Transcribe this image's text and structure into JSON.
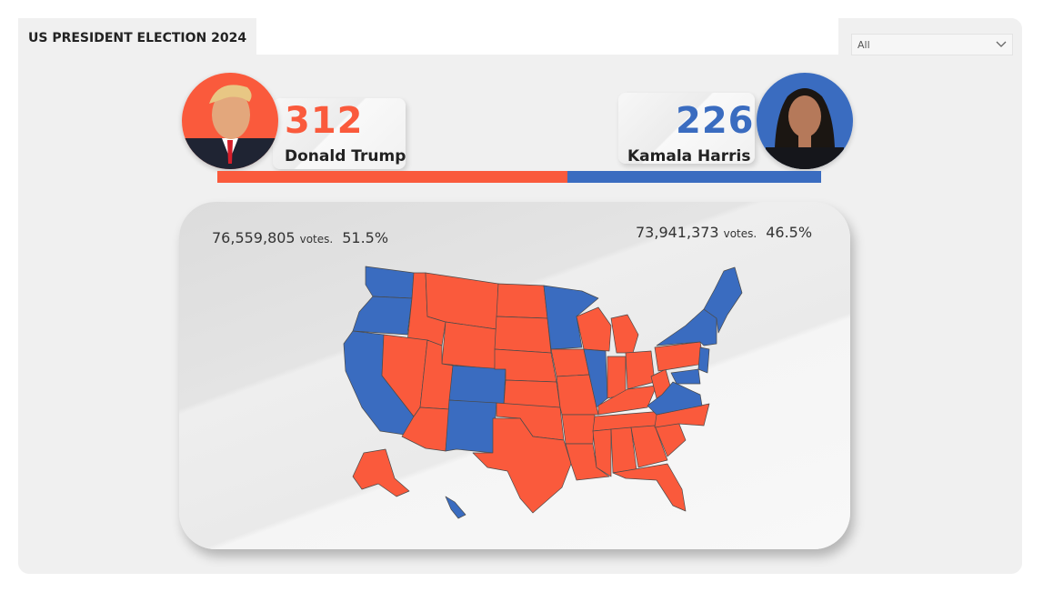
{
  "header": {
    "title": "US PRESIDENT ELECTION 2024"
  },
  "filter": {
    "selected": "All",
    "chevron_icon": "chevron-down-icon"
  },
  "colors": {
    "republican": "#fa5a3c",
    "democrat": "#3a6cc0",
    "background": "#f0f0f0"
  },
  "candidates": [
    {
      "name": "Donald Trump",
      "electoral_votes": "312",
      "popular_votes": "76,559,805",
      "votes_label": "votes.",
      "percent": "51.5%",
      "color": "#fa5a3c"
    },
    {
      "name": "Kamala Harris",
      "electoral_votes": "226",
      "popular_votes": "73,941,373",
      "votes_label": "votes.",
      "percent": "46.5%",
      "color": "#3a6cc0"
    }
  ],
  "electoral_bar": {
    "total": 538,
    "trump": 312,
    "harris": 226
  }
}
